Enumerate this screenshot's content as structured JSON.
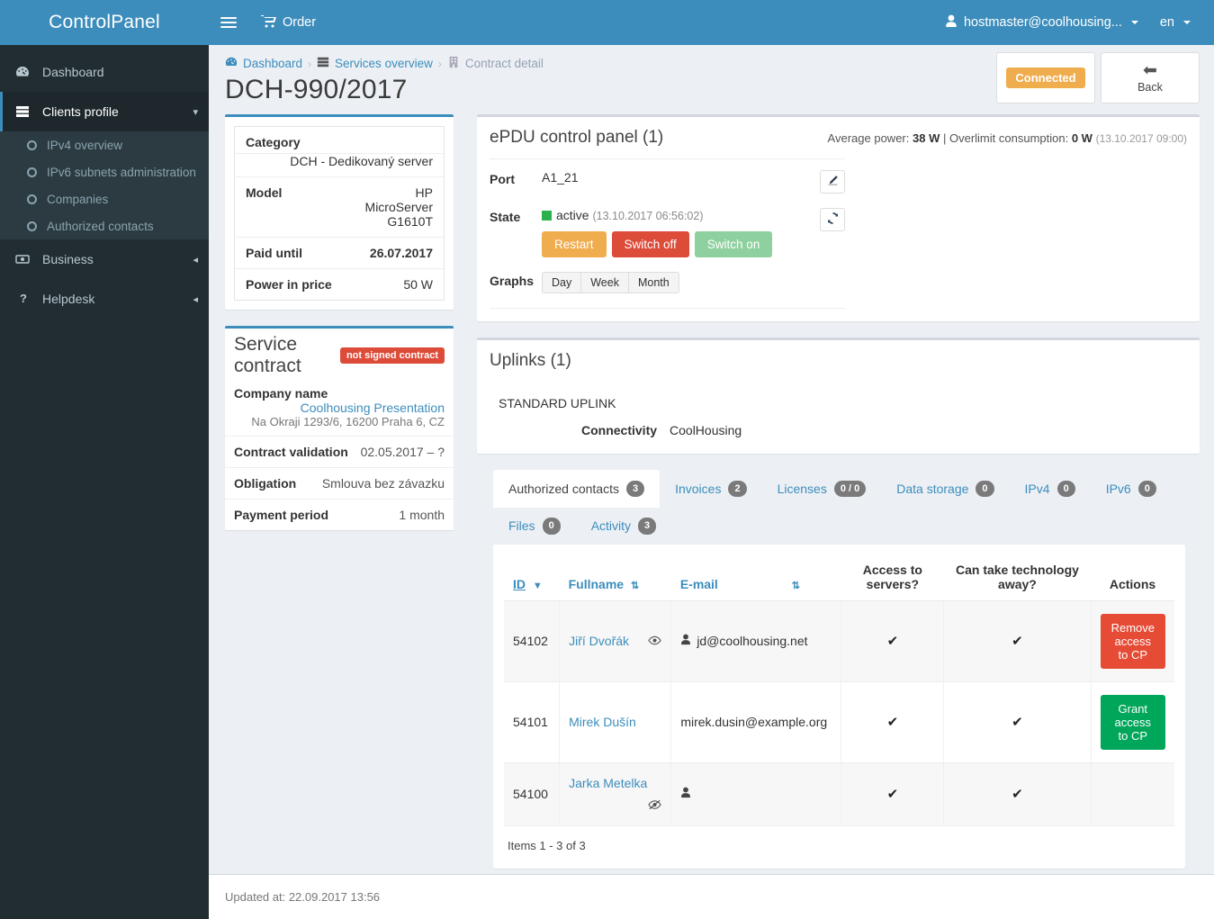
{
  "brand": {
    "title": "ControlPanel"
  },
  "navbar": {
    "order_label": "Order",
    "user_label": "hostmaster@coolhousing...",
    "lang_label": "en"
  },
  "sidebar": {
    "items": [
      {
        "label": "Dashboard",
        "icon": "dashboard-icon"
      },
      {
        "label": "Clients profile",
        "icon": "server-icon",
        "active": true
      },
      {
        "label": "Business",
        "icon": "money-icon"
      },
      {
        "label": "Helpdesk",
        "icon": "question-icon"
      }
    ],
    "submenu": [
      {
        "label": "IPv4 overview"
      },
      {
        "label": "IPv6 subnets administration"
      },
      {
        "label": "Companies"
      },
      {
        "label": "Authorized contacts"
      }
    ]
  },
  "breadcrumb": {
    "dashboard": "Dashboard",
    "services": "Services overview",
    "current": "Contract detail",
    "sep": "›"
  },
  "page": {
    "title": "DCH-990/2017",
    "connected_label": "Connected",
    "back_label": "Back"
  },
  "detail": {
    "rows": [
      {
        "label": "Category",
        "value": "DCH - Dedikovaný server",
        "stacked": true
      },
      {
        "label": "Model",
        "value": "HP MicroServer G1610T"
      },
      {
        "label": "Paid until",
        "value": "26.07.2017",
        "red": true
      },
      {
        "label": "Power in price",
        "value": "50 W"
      }
    ]
  },
  "contract": {
    "title": "Service contract",
    "badge": "not signed contract",
    "company_label": "Company name",
    "company_name": "Coolhousing Presentation",
    "company_address": "Na Okraji 1293/6, 16200 Praha 6, CZ",
    "rows": [
      {
        "label": "Contract validation",
        "value": "02.05.2017 – ?"
      },
      {
        "label": "Obligation",
        "value": "Smlouva bez závazku"
      },
      {
        "label": "Payment period",
        "value": "1 month"
      }
    ]
  },
  "epdu": {
    "title": "ePDU control panel (1)",
    "meta_avg_label": "Average power:",
    "meta_avg_value": "38 W",
    "meta_sep": "|",
    "meta_over_label": "Overlimit consumption:",
    "meta_over_value": "0 W",
    "meta_time": "(13.10.2017 09:00)",
    "port_label": "Port",
    "port_value": "A1_21",
    "state_label": "State",
    "state_value": "active",
    "state_time": "(13.10.2017 06:56:02)",
    "btn_restart": "Restart",
    "btn_switch_off": "Switch off",
    "btn_switch_on": "Switch on",
    "graphs_label": "Graphs",
    "graph_day": "Day",
    "graph_week": "Week",
    "graph_month": "Month"
  },
  "uplinks": {
    "title": "Uplinks (1)",
    "name": "STANDARD UPLINK",
    "connectivity_label": "Connectivity",
    "connectivity_value": "CoolHousing"
  },
  "tabs": [
    {
      "label": "Authorized contacts",
      "badge": "3",
      "active": true
    },
    {
      "label": "Invoices",
      "badge": "2"
    },
    {
      "label": "Licenses",
      "badge": "0 / 0"
    },
    {
      "label": "Data storage",
      "badge": "0"
    },
    {
      "label": "IPv4",
      "badge": "0"
    },
    {
      "label": "IPv6",
      "badge": "0"
    },
    {
      "label": "Files",
      "badge": "0"
    },
    {
      "label": "Activity",
      "badge": "3"
    }
  ],
  "contacts_table": {
    "headers": {
      "id": "ID",
      "fullname": "Fullname",
      "email": "E-mail",
      "access": "Access to servers?",
      "access_l1": "Access to",
      "access_l2": "servers?",
      "takeaway_l1": "Can take technology",
      "takeaway_l2": "away?",
      "actions": "Actions"
    },
    "rows": [
      {
        "id": "54102",
        "fullname": "Jiří Dvořák",
        "email": "jd@coolhousing.net",
        "email_has_icon": true,
        "name_icon": "eye-icon",
        "access": "✔",
        "takeaway": "✔",
        "action": "Remove access to CP",
        "action_type": "remove",
        "shaded": true
      },
      {
        "id": "54101",
        "fullname": "Mirek Dušín",
        "email": "mirek.dusin@example.org",
        "email_has_icon": false,
        "name_icon": "",
        "access": "✔",
        "takeaway": "✔",
        "action": "Grant access to CP",
        "action_type": "grant",
        "shaded": false
      },
      {
        "id": "54100",
        "fullname": "Jarka Metelka",
        "email": "",
        "email_has_icon": true,
        "name_icon": "eye-slash-icon",
        "access": "✔",
        "takeaway": "✔",
        "action": "",
        "action_type": "none",
        "shaded": true
      }
    ],
    "items_note": "Items 1 - 3 of 3"
  },
  "footer": {
    "updated": "Updated at: 22.09.2017 13:56"
  },
  "colors": {
    "brand_blue": "#3c8dbc",
    "sidebar_dark": "#222d32",
    "orange": "#f0ad4e",
    "red": "#dd4b39",
    "green": "#00a65a"
  }
}
